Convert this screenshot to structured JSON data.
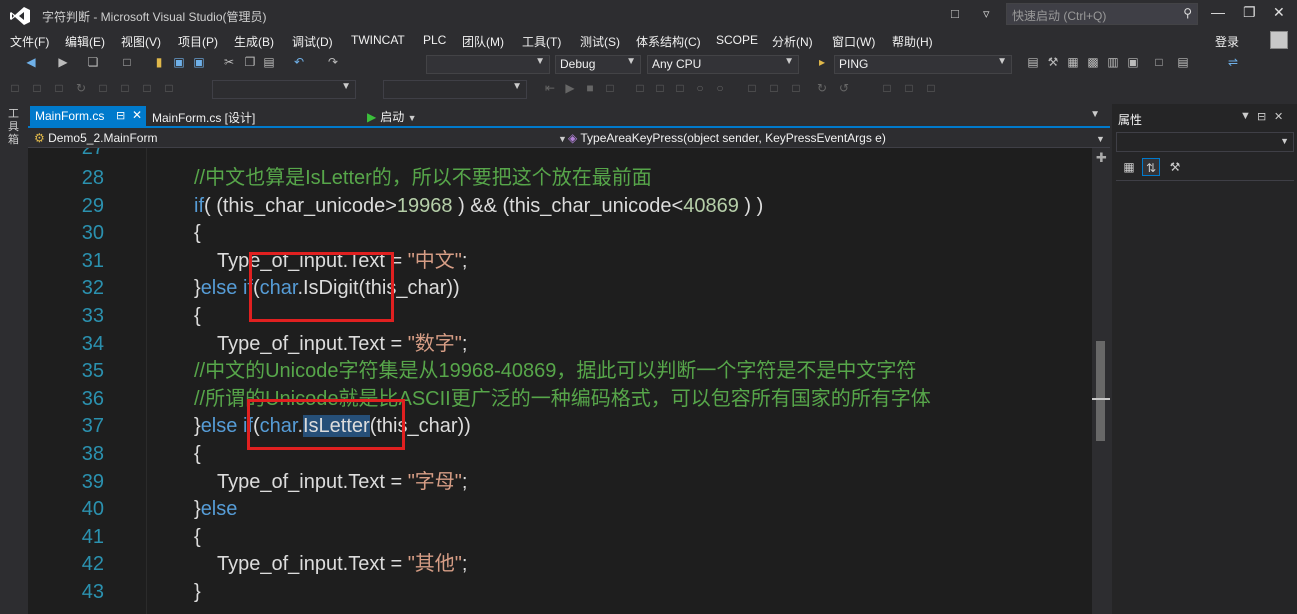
{
  "window": {
    "title": "字符判断 - Microsoft Visual Studio(管理员)",
    "quick_launch_placeholder": "快速启动 (Ctrl+Q)",
    "login_label": "登录"
  },
  "menu": [
    "文件(F)",
    "编辑(E)",
    "视图(V)",
    "项目(P)",
    "生成(B)",
    "调试(D)",
    "TWINCAT",
    "PLC",
    "团队(M)",
    "工具(T)",
    "测试(S)",
    "体系结构(C)",
    "SCOPE",
    "分析(N)",
    "窗口(W)",
    "帮助(H)"
  ],
  "toolbar": {
    "start_label": "启动",
    "config": "Debug",
    "platform": "Any CPU",
    "ping_target": "PING"
  },
  "left_toolwindow_label": "工具箱",
  "tabs": [
    {
      "label": "MainForm.cs",
      "active": true
    },
    {
      "label": "MainForm.cs [设计]",
      "active": false
    }
  ],
  "navbar": {
    "class_path": "Demo5_2.MainForm",
    "member": "TypeAreaKeyPress(object sender, KeyPressEventArgs e)"
  },
  "properties_panel": {
    "title": "属性"
  },
  "editor": {
    "partial_line_number": "27",
    "lines": [
      {
        "no": "28",
        "indent": 1,
        "tokens": [
          {
            "t": "//中文也算是IsLetter的，所以不要把这个放在最前面",
            "c": "com"
          }
        ]
      },
      {
        "no": "29",
        "indent": 1,
        "tokens": [
          {
            "t": "if",
            "c": "kw"
          },
          {
            "t": "( (this_char_unicode>",
            "c": "op"
          },
          {
            "t": "19968",
            "c": "num"
          },
          {
            "t": " ) && (this_char_unicode<",
            "c": "op"
          },
          {
            "t": "40869",
            "c": "num"
          },
          {
            "t": " ) )",
            "c": "op"
          }
        ]
      },
      {
        "no": "30",
        "indent": 1,
        "tokens": [
          {
            "t": "{",
            "c": "op"
          }
        ]
      },
      {
        "no": "31",
        "indent": 2,
        "tokens": [
          {
            "t": "Type_of_input.Text = ",
            "c": "op"
          },
          {
            "t": "\"中文\"",
            "c": "str"
          },
          {
            "t": ";",
            "c": "op"
          }
        ]
      },
      {
        "no": "32",
        "indent": 1,
        "tokens": [
          {
            "t": "}",
            "c": "op"
          },
          {
            "t": "else",
            "c": "kw"
          },
          {
            "t": " ",
            "c": "op"
          },
          {
            "t": "if",
            "c": "kw"
          },
          {
            "t": "(",
            "c": "op"
          },
          {
            "t": "char",
            "c": "kw"
          },
          {
            "t": ".IsDigit(this_char))",
            "c": "op"
          }
        ]
      },
      {
        "no": "33",
        "indent": 1,
        "tokens": [
          {
            "t": "{",
            "c": "op"
          }
        ]
      },
      {
        "no": "34",
        "indent": 2,
        "tokens": [
          {
            "t": "Type_of_input.Text = ",
            "c": "op"
          },
          {
            "t": "\"数字\"",
            "c": "str"
          },
          {
            "t": ";",
            "c": "op"
          }
        ]
      },
      {
        "no": "35",
        "indent": 1,
        "tokens": [
          {
            "t": "//中文的Unicode字符集是从19968-40869，据此可以判断一个字符是不是中文字符",
            "c": "com"
          }
        ]
      },
      {
        "no": "36",
        "indent": 1,
        "tokens": [
          {
            "t": "//所谓的Unicode就是比ASCII更广泛的一种编码格式，可以包容所有国家的所有字体",
            "c": "com"
          }
        ]
      },
      {
        "no": "37",
        "indent": 1,
        "tokens": [
          {
            "t": "}",
            "c": "op"
          },
          {
            "t": "else",
            "c": "kw"
          },
          {
            "t": " ",
            "c": "op"
          },
          {
            "t": "if",
            "c": "kw"
          },
          {
            "t": "(",
            "c": "op"
          },
          {
            "t": "char",
            "c": "kw"
          },
          {
            "t": ".",
            "c": "op"
          },
          {
            "t": "IsLetter",
            "c": "sel"
          },
          {
            "t": "(this_char))",
            "c": "op"
          }
        ]
      },
      {
        "no": "38",
        "indent": 1,
        "tokens": [
          {
            "t": "{",
            "c": "op"
          }
        ]
      },
      {
        "no": "39",
        "indent": 2,
        "tokens": [
          {
            "t": "Type_of_input.Text = ",
            "c": "op"
          },
          {
            "t": "\"字母\"",
            "c": "str"
          },
          {
            "t": ";",
            "c": "op"
          }
        ]
      },
      {
        "no": "40",
        "indent": 1,
        "tokens": [
          {
            "t": "}",
            "c": "op"
          },
          {
            "t": "else",
            "c": "kw"
          }
        ]
      },
      {
        "no": "41",
        "indent": 1,
        "tokens": [
          {
            "t": "{",
            "c": "op"
          }
        ]
      },
      {
        "no": "42",
        "indent": 2,
        "tokens": [
          {
            "t": "Type_of_input.Text = ",
            "c": "op"
          },
          {
            "t": "\"其他\"",
            "c": "str"
          },
          {
            "t": ";",
            "c": "op"
          }
        ]
      },
      {
        "no": "43",
        "indent": 1,
        "tokens": [
          {
            "t": "}",
            "c": "op"
          }
        ]
      }
    ]
  },
  "colors": {
    "accent": "#007acc",
    "comment": "#57a64a",
    "keyword": "#569cd6",
    "string": "#d69d85",
    "number": "#b5cea8",
    "line_number": "#2b91af",
    "highlight_box": "#e02020"
  }
}
